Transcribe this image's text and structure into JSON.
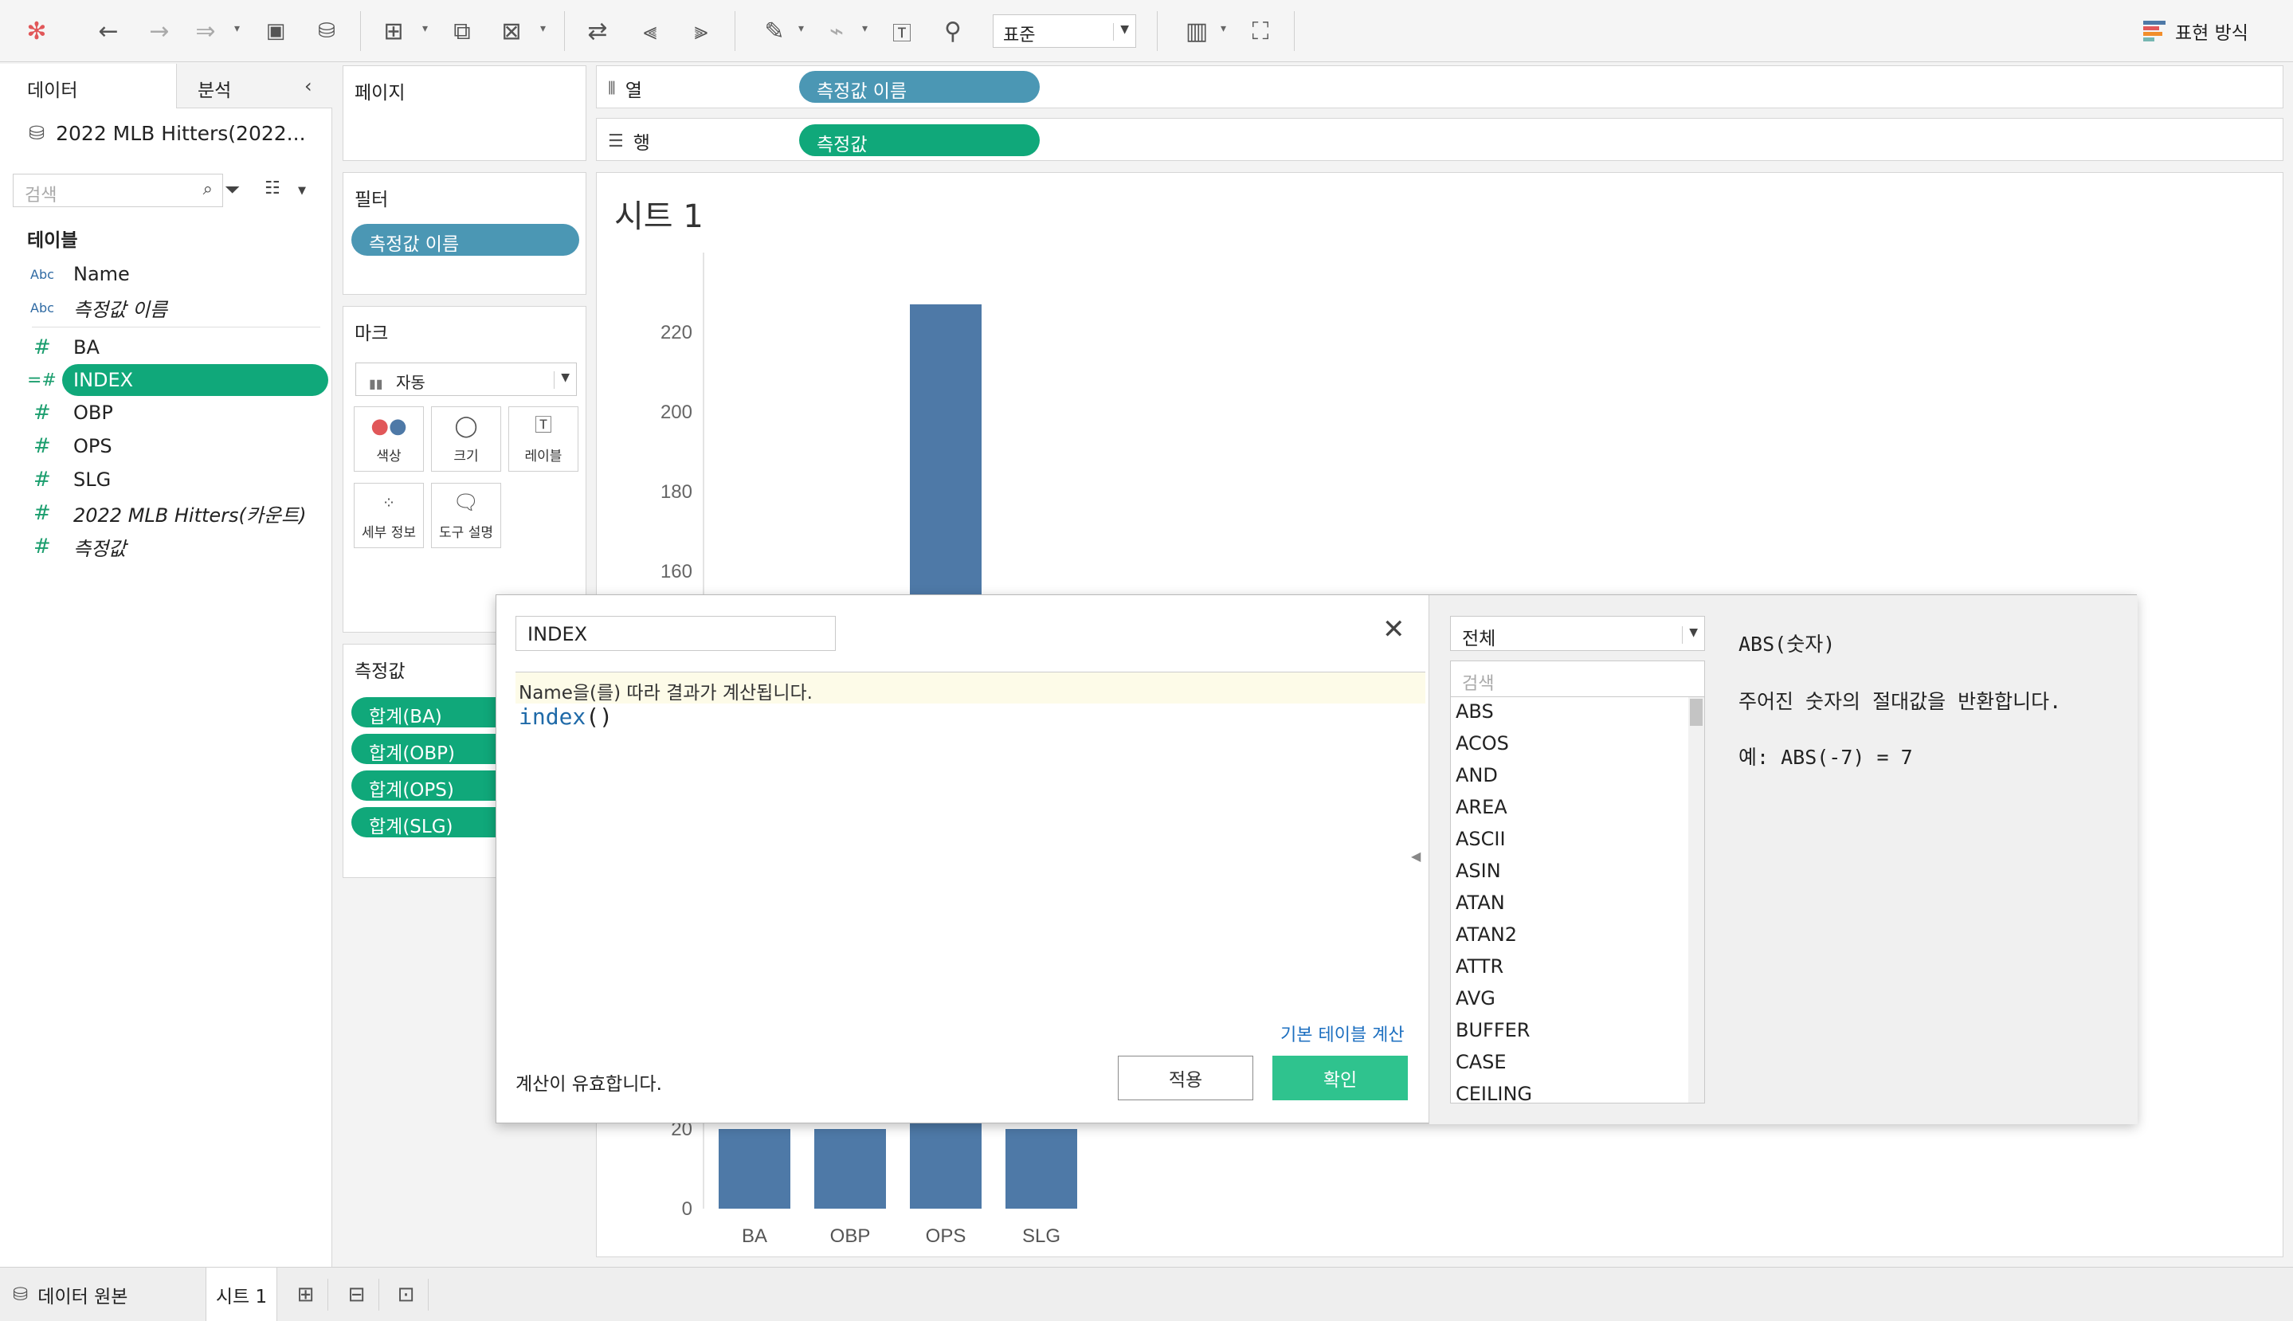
{
  "toolbar": {
    "fit_value": "표준",
    "show_me_label": "표현 방식",
    "show_me_colors": [
      "#4e79a7",
      "#e15759",
      "#f28e2b",
      "#76b7b2"
    ]
  },
  "data_pane": {
    "tab_data": "데이터",
    "tab_analytics": "분석",
    "datasource_name": "2022 MLB Hitters(2022...",
    "search_placeholder": "검색",
    "tables_heading": "테이블",
    "fields": [
      {
        "type_label": "Abc",
        "name": "Name"
      },
      {
        "type_label": "Abc",
        "name": "측정값 이름"
      },
      {
        "type_label": "#",
        "name": "BA"
      },
      {
        "type_label": "=#",
        "name": "INDEX"
      },
      {
        "type_label": "#",
        "name": "OBP"
      },
      {
        "type_label": "#",
        "name": "OPS"
      },
      {
        "type_label": "#",
        "name": "SLG"
      },
      {
        "type_label": "#",
        "name": "2022 MLB Hitters(카운트)"
      },
      {
        "type_label": "#",
        "name": "측정값"
      }
    ]
  },
  "cards": {
    "pages_title": "페이지",
    "filters_title": "필터",
    "filter_pill": "측정값 이름",
    "marks_title": "마크",
    "marks_type": "자동",
    "mark_buttons": [
      "색상",
      "크기",
      "레이블",
      "세부 정보",
      "도구 설명"
    ],
    "measure_values_title": "측정값",
    "measure_pills": [
      "합계(BA)",
      "합계(OBP)",
      "합계(OPS)",
      "합계(SLG)"
    ]
  },
  "shelves": {
    "columns_label": "열",
    "columns_pill": "측정값 이름",
    "rows_label": "행",
    "rows_pill": "측정값"
  },
  "sheet": {
    "title": "시트 1"
  },
  "chart_data": {
    "type": "bar",
    "categories": [
      "BA",
      "OBP",
      "OPS",
      "SLG"
    ],
    "values": [
      20,
      20,
      227,
      20
    ],
    "y_ticks_visible": [
      0,
      20,
      160,
      180,
      200,
      220
    ],
    "ylim": [
      0,
      240
    ],
    "bar_color": "#4e79a7",
    "note": ""
  },
  "bottom_bar": {
    "datasource_tab": "데이터 원본",
    "sheet_tab": "시트 1"
  },
  "dialog": {
    "calc_name": "INDEX",
    "hint": "Name을(를) 따라 결과가 계산됩니다.",
    "formula_fn": "index",
    "formula_parens": "()",
    "default_table_calc": "기본 테이블 계산",
    "status": "계산이 유효합니다.",
    "apply_label": "적용",
    "ok_label": "확인",
    "function_category": "전체",
    "function_search_placeholder": "검색",
    "functions": [
      "ABS",
      "ACOS",
      "AND",
      "AREA",
      "ASCII",
      "ASIN",
      "ATAN",
      "ATAN2",
      "ATTR",
      "AVG",
      "BUFFER",
      "CASE",
      "CEILING"
    ],
    "fn_signature": "ABS(숫자)",
    "fn_description": "주어진 숫자의 절대값을 반환합니다.",
    "fn_example": "예: ABS(-7) = 7"
  }
}
